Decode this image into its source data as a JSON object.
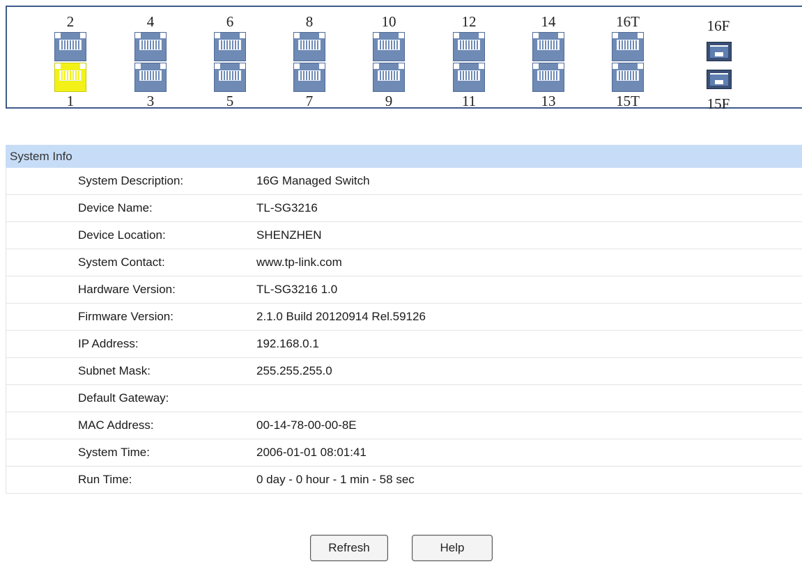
{
  "ports": {
    "columns": [
      {
        "top": "2",
        "bottom": "1",
        "bottom_active": true
      },
      {
        "top": "4",
        "bottom": "3",
        "bottom_active": false
      },
      {
        "top": "6",
        "bottom": "5",
        "bottom_active": false
      },
      {
        "top": "8",
        "bottom": "7",
        "bottom_active": false
      },
      {
        "top": "10",
        "bottom": "9",
        "bottom_active": false
      },
      {
        "top": "12",
        "bottom": "11",
        "bottom_active": false
      },
      {
        "top": "14",
        "bottom": "13",
        "bottom_active": false
      },
      {
        "top": "16T",
        "bottom": "15T",
        "bottom_active": false
      }
    ],
    "sfp": {
      "top": "16F",
      "bottom": "15F"
    },
    "colors": {
      "port": "#6e8ab5",
      "active": "#f2f218",
      "sfp": "#3a4f75",
      "border": "#3d5a8a"
    }
  },
  "system_info": {
    "title": "System Info",
    "header_color": "#c7ddf7",
    "rows": [
      {
        "label": "System Description:",
        "value": "16G Managed Switch"
      },
      {
        "label": "Device Name:",
        "value": "TL-SG3216"
      },
      {
        "label": "Device Location:",
        "value": "SHENZHEN"
      },
      {
        "label": "System Contact:",
        "value": "www.tp-link.com"
      },
      {
        "label": "Hardware Version:",
        "value": "TL-SG3216 1.0"
      },
      {
        "label": "Firmware Version:",
        "value": "2.1.0 Build 20120914 Rel.59126"
      },
      {
        "label": "IP Address:",
        "value": "192.168.0.1"
      },
      {
        "label": "Subnet Mask:",
        "value": "255.255.255.0"
      },
      {
        "label": "Default Gateway:",
        "value": ""
      },
      {
        "label": "MAC Address:",
        "value": "00-14-78-00-00-8E"
      },
      {
        "label": "System Time:",
        "value": "2006-01-01 08:01:41"
      },
      {
        "label": "Run Time:",
        "value": "0 day - 0 hour - 1 min - 58 sec"
      }
    ]
  },
  "buttons": {
    "refresh": "Refresh",
    "help": "Help"
  }
}
